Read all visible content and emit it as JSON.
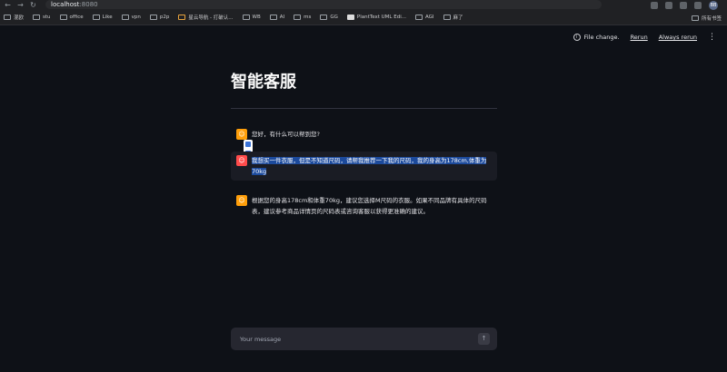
{
  "browser": {
    "url_host": "localhost",
    "url_port": ":8080",
    "bookmarks": [
      "混欧",
      "stu",
      "office",
      "Like",
      "vpn",
      "p2p",
      "星云导航 - 打破认...",
      "WB",
      "AI",
      "ms",
      "GG",
      "PlantText UML Edi...",
      "AGI",
      "麻了"
    ],
    "all_bookmarks": "所有书签",
    "profile_initials": "BB"
  },
  "header": {
    "status_text": "File change.",
    "rerun_label": "Rerun",
    "always_rerun_label": "Always rerun",
    "menu_icon": "⋮"
  },
  "main": {
    "title": "智能客服",
    "messages": [
      {
        "role": "assistant",
        "text": "您好，有什么可以帮到您?"
      },
      {
        "role": "user",
        "text": "我想买一件衣服，但是不知道尺码，请帮我推荐一下我的尺码，我的身高为178cm,体重为70kg"
      },
      {
        "role": "assistant",
        "text": "根据您的身高178cm和体重70kg，建议您选择M尺码的衣服。如果不同品牌有具体的尺码表，建议参考商品详情页的尺码表或咨询客服以获得更准确的建议。"
      }
    ]
  },
  "chat_input": {
    "placeholder": "Your message",
    "send_icon": "↑"
  },
  "colors": {
    "background": "#0e1117",
    "bot_avatar": "#ff9f0a",
    "user_avatar": "#ff4b4b",
    "selection": "#1c4a9c"
  }
}
